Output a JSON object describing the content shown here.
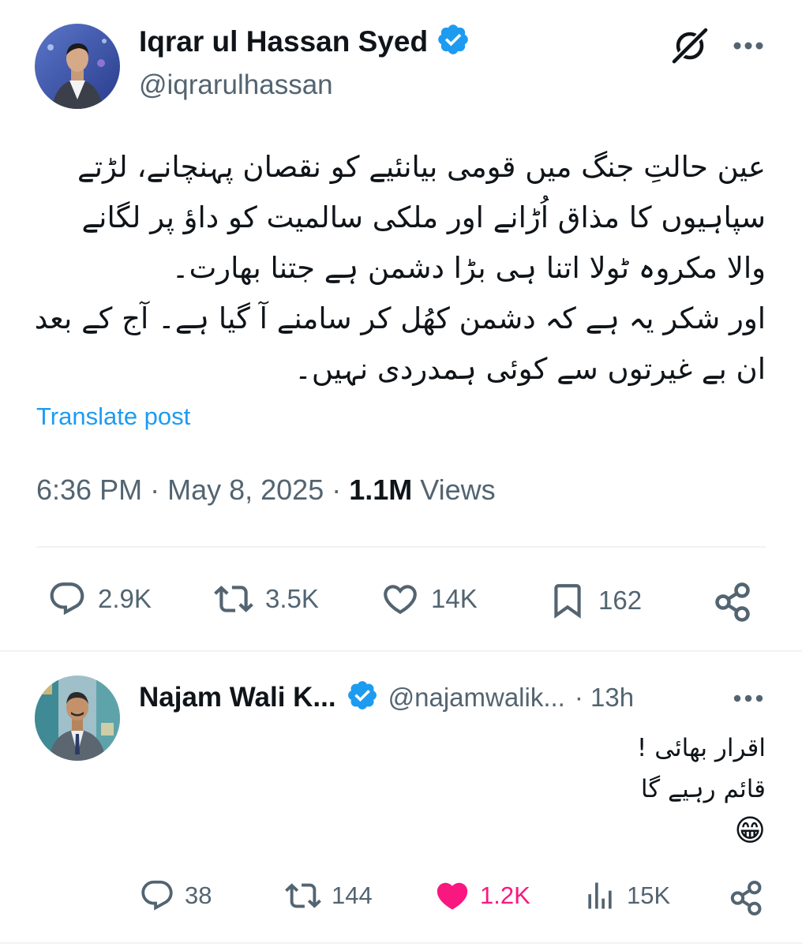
{
  "post": {
    "author_name": "Iqrar ul Hassan Syed",
    "author_handle": "@iqrarulhassan",
    "body_lines": [
      "عین حالتِ جنگ میں قومی بیانئیے کو نقصان پہنچانے، لڑتے",
      "سپاہیوں کا مذاق اُڑانے اور ملکی سالمیت کو داؤ پر لگانے",
      "والا مکروہ ٹولا اتنا ہی بڑا دشمن ہے جتنا بھارت۔",
      "اور شکر یہ ہے کہ دشمن کھُل کر سامنے آ گیا ہے۔ آج کے بعد",
      "ان بے غیرتوں سے کوئی ہمدردی نہیں۔"
    ],
    "translate_label": "Translate post",
    "time": "6:36 PM",
    "date": "May 8, 2025",
    "views_count": "1.1M",
    "views_label": "Views",
    "actions": {
      "replies": "2.9K",
      "reposts": "3.5K",
      "likes": "14K",
      "bookmarks": "162"
    },
    "icons": [
      "grok-icon",
      "more-icon",
      "reply-icon",
      "repost-icon",
      "like-icon",
      "bookmark-icon",
      "share-icon"
    ]
  },
  "reply": {
    "author_name": "Najam Wali K...",
    "author_handle": "@najamwalik...",
    "age": "· 13h",
    "body_lines": [
      "اقرار بھائی !",
      "قائم رہیے گا",
      "😁"
    ],
    "actions": {
      "replies": "38",
      "reposts": "144",
      "likes": "1.2K",
      "views": "15K"
    }
  },
  "colors": {
    "verified_blue": "#1d9bf0",
    "link_blue": "#1d9bf0",
    "muted_text": "#536471",
    "like_pink": "#f91880"
  }
}
